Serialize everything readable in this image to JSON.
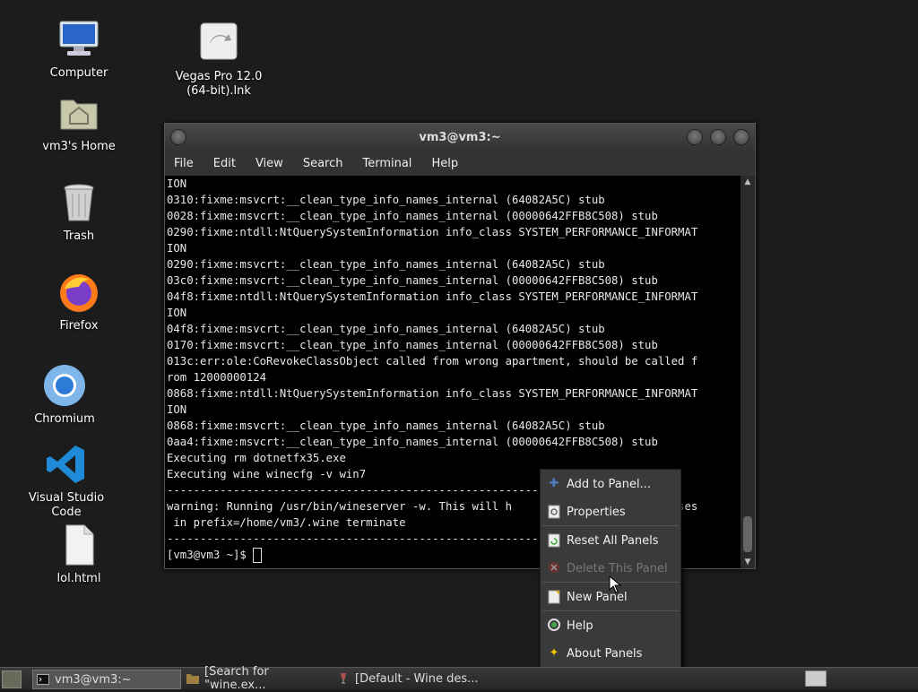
{
  "desktop": {
    "icons": [
      {
        "label": "Computer",
        "icon": "computer-icon"
      },
      {
        "label": "vm3's Home",
        "icon": "home-folder-icon"
      },
      {
        "label": "Trash",
        "icon": "trash-icon"
      },
      {
        "label": "Firefox",
        "icon": "firefox-icon"
      },
      {
        "label": "Chromium",
        "icon": "chromium-icon"
      },
      {
        "label": "Visual Studio Code",
        "icon": "vscode-icon"
      },
      {
        "label": "lol.html",
        "icon": "file-icon"
      },
      {
        "label": "Vegas Pro 12.0 (64-bit).lnk",
        "icon": "shortcut-icon"
      }
    ]
  },
  "terminal": {
    "title": "vm3@vm3:~",
    "menu": [
      "File",
      "Edit",
      "View",
      "Search",
      "Terminal",
      "Help"
    ],
    "lines": [
      "ION",
      "0310:fixme:msvcrt:__clean_type_info_names_internal (64082A5C) stub",
      "0028:fixme:msvcrt:__clean_type_info_names_internal (00000642FFB8C508) stub",
      "0290:fixme:ntdll:NtQuerySystemInformation info_class SYSTEM_PERFORMANCE_INFORMAT",
      "ION",
      "0290:fixme:msvcrt:__clean_type_info_names_internal (64082A5C) stub",
      "03c0:fixme:msvcrt:__clean_type_info_names_internal (00000642FFB8C508) stub",
      "04f8:fixme:ntdll:NtQuerySystemInformation info_class SYSTEM_PERFORMANCE_INFORMAT",
      "ION",
      "04f8:fixme:msvcrt:__clean_type_info_names_internal (64082A5C) stub",
      "0170:fixme:msvcrt:__clean_type_info_names_internal (00000642FFB8C508) stub",
      "013c:err:ole:CoRevokeClassObject called from wrong apartment, should be called f",
      "rom 12000000124",
      "0868:fixme:ntdll:NtQuerySystemInformation info_class SYSTEM_PERFORMANCE_INFORMAT",
      "ION",
      "0868:fixme:msvcrt:__clean_type_info_names_internal (64082A5C) stub",
      "0aa4:fixme:msvcrt:__clean_type_info_names_internal (00000642FFB8C508) stub",
      "Executing rm dotnetfx35.exe",
      "Executing wine winecfg -v win7",
      "-------------------------------------------------------------",
      "warning: Running /usr/bin/wineserver -w. This will h                   processes",
      " in prefix=/home/vm3/.wine terminate",
      "-------------------------------------------------------------"
    ],
    "prompt": "[vm3@vm3 ~]$ "
  },
  "context_menu": {
    "items": [
      {
        "label": "Add to Panel...",
        "icon": "plus-icon",
        "enabled": true
      },
      {
        "label": "Properties",
        "icon": "properties-icon",
        "enabled": true
      },
      {
        "label": "Reset All Panels",
        "icon": "reset-icon",
        "enabled": true
      },
      {
        "label": "Delete This Panel",
        "icon": "delete-icon",
        "enabled": false
      },
      {
        "label": "New Panel",
        "icon": "new-panel-icon",
        "enabled": true
      },
      {
        "label": "Help",
        "icon": "help-icon",
        "enabled": true
      },
      {
        "label": "About Panels",
        "icon": "star-icon",
        "enabled": true
      }
    ]
  },
  "taskbar": {
    "tasks": [
      {
        "label": "vm3@vm3:~",
        "active": true
      },
      {
        "label": "[Search for \"wine.ex...",
        "active": false
      },
      {
        "label": "[Default - Wine des...",
        "active": false
      }
    ]
  },
  "colors": {
    "accent": "#4a7fc1",
    "menu_bg": "#3a3a3a",
    "terminal_bg": "#000000"
  }
}
